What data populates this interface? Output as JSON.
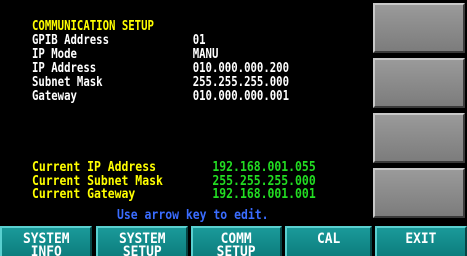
{
  "setup": {
    "title": "COMMUNICATION SETUP",
    "rows": [
      {
        "label": "GPIB Address",
        "value": "01"
      },
      {
        "label": "IP Mode",
        "value": "MANU"
      },
      {
        "label": "IP Address",
        "value": "010.000.000.200"
      },
      {
        "label": "Subnet Mask",
        "value": "255.255.255.000"
      },
      {
        "label": "Gateway",
        "value": "010.000.000.001"
      }
    ]
  },
  "current": {
    "rows": [
      {
        "label": "Current IP Address",
        "value": "192.168.001.055"
      },
      {
        "label": "Current Subnet Mask",
        "value": "255.255.255.000"
      },
      {
        "label": "Current Gateway",
        "value": "192.168.001.001"
      }
    ]
  },
  "hint": "Use arrow key to edit.",
  "softkeys": [
    {
      "label": "SYSTEM\nINFO"
    },
    {
      "label": "SYSTEM\nSETUP"
    },
    {
      "label": "COMM\nSETUP"
    },
    {
      "label": "CAL"
    },
    {
      "label": "EXIT"
    }
  ],
  "colors": {
    "background": "#000000",
    "title": "#ffff00",
    "value_current": "#22dd22",
    "hint": "#3a6cff",
    "softkey_bg": "#108888",
    "side_button_bg": "#8a8a8a"
  }
}
